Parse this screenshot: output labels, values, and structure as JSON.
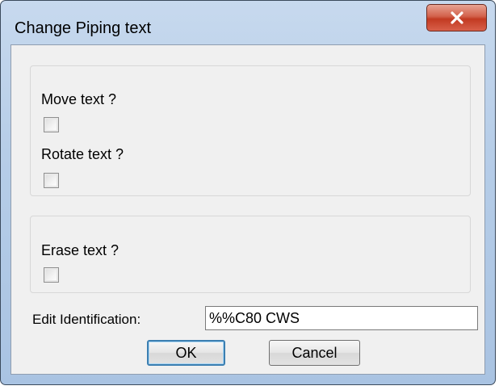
{
  "window": {
    "title": "Change Piping text",
    "close_glyph": "X"
  },
  "options": {
    "move_text_label": "Move text ?",
    "move_text_checked": false,
    "rotate_text_label": "Rotate text ?",
    "rotate_text_checked": false,
    "erase_text_label": "Erase text ?",
    "erase_text_checked": false
  },
  "identification": {
    "label": "Edit Identification:",
    "value": "%%C80 CWS"
  },
  "buttons": {
    "ok_label": "OK",
    "cancel_label": "Cancel"
  },
  "colors": {
    "close_button": "#c8402a",
    "default_button_border": "#3c7fb1",
    "client_background": "#f0f0f0"
  }
}
